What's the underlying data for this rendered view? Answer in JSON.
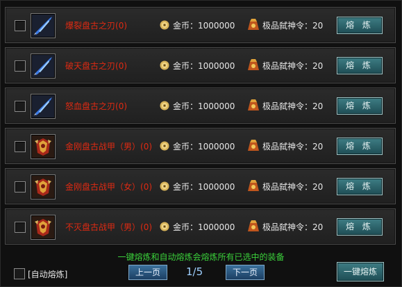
{
  "items": [
    {
      "name": "爆裂盘古之刃",
      "suffix": "(0)",
      "gold": "金币：1000000",
      "order": "极品弑神令：20",
      "button": "熔 炼",
      "icon": "blue-blade-icon"
    },
    {
      "name": "破天盘古之刃",
      "suffix": "(0)",
      "gold": "金币：1000000",
      "order": "极品弑神令：20",
      "button": "熔 炼",
      "icon": "blue-blade-icon"
    },
    {
      "name": "怒血盘古之刃",
      "suffix": "(0)",
      "gold": "金币：1000000",
      "order": "极品弑神令：20",
      "button": "熔 炼",
      "icon": "blue-blade-icon"
    },
    {
      "name": "金刚盘古战甲（男）",
      "suffix": "(0)",
      "gold": "金币：1000000",
      "order": "极品弑神令：20",
      "button": "熔 炼",
      "icon": "red-armor-icon"
    },
    {
      "name": "金刚盘古战甲（女）",
      "suffix": "(0)",
      "gold": "金币：1000000",
      "order": "极品弑神令：20",
      "button": "熔 炼",
      "icon": "red-armor-icon"
    },
    {
      "name": "不灭盘古战甲（男）",
      "suffix": "(0)",
      "gold": "金币：1000000",
      "order": "极品弑神令：20",
      "button": "熔 炼",
      "icon": "red-armor-icon"
    }
  ],
  "footer": {
    "hint": "一键熔炼和自动熔炼会熔炼所有已选中的装备",
    "auto_label": "[自动熔炼]",
    "prev": "上一页",
    "page": "1/5",
    "next": "下一页",
    "one_key": "一键熔炼"
  },
  "colors": {
    "item_name": "#e02a12",
    "hint": "#3bd23b",
    "button": "#2e6a72"
  }
}
